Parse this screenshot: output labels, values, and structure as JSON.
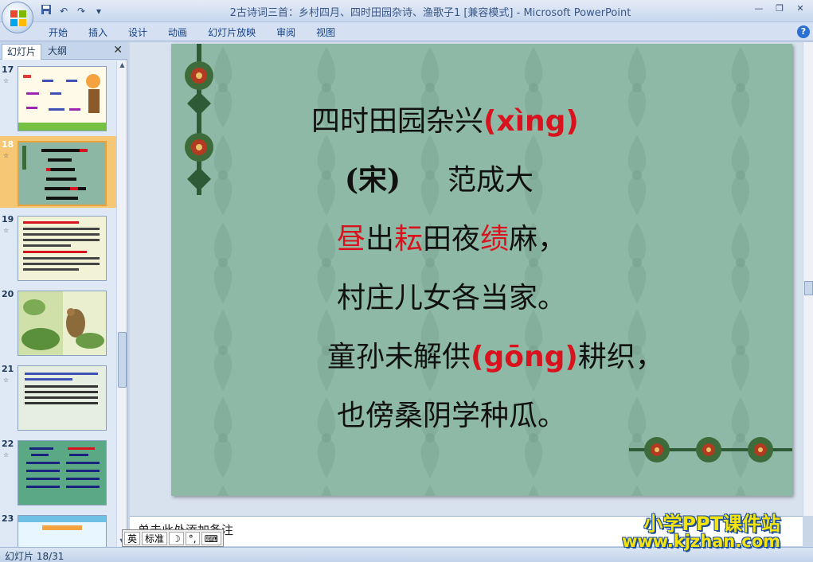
{
  "window": {
    "title": "2古诗词三首：乡村四月、四时田园杂诗、渔歌子1 [兼容模式] - Microsoft PowerPoint"
  },
  "ribbon": {
    "tabs": [
      "开始",
      "插入",
      "设计",
      "动画",
      "幻灯片放映",
      "审阅",
      "视图"
    ]
  },
  "left_panel": {
    "tab_slides": "幻灯片",
    "tab_outline": "大纲",
    "slide_numbers": [
      "17",
      "18",
      "19",
      "20",
      "21",
      "22",
      "23"
    ],
    "selected_slide": "18"
  },
  "slide": {
    "title": "四时田园杂兴",
    "title_pinyin": "(xìng)",
    "dynasty": "(宋)",
    "author": "范成大",
    "line1": {
      "a": "昼",
      "b": "出",
      "c": "耘",
      "d": "田夜",
      "e": "绩",
      "f": "麻，"
    },
    "line2": "村庄儿女各当家。",
    "line3": {
      "a": "童孙未解供",
      "pinyin": "(gōng)",
      "b": "耕织，"
    },
    "line4": "也傍桑阴学种瓜。"
  },
  "notes": {
    "placeholder": "单击此处添加备注"
  },
  "ime": {
    "mode": "标准"
  },
  "status": {
    "slide_position": "幻灯片 18/31"
  },
  "watermark": {
    "line1": "小学PPT课件站",
    "line2": "www.kjzhan.com"
  },
  "colors": {
    "slide_bg": "#8db7a5",
    "accent_red": "#d8131d",
    "watermark_yellow": "#f5e40e"
  }
}
